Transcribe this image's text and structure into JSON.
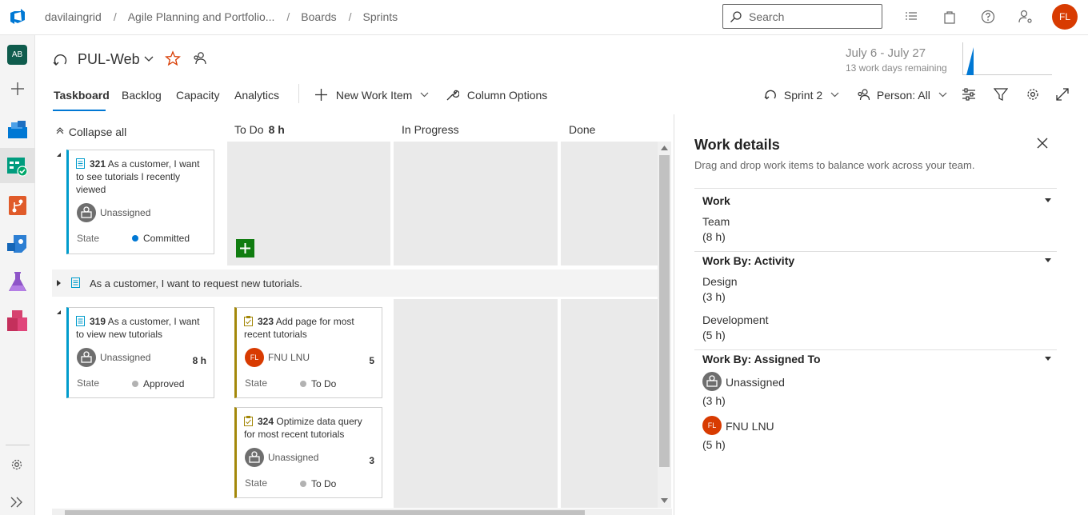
{
  "breadcrumb": [
    "davilaingrid",
    "Agile Planning and Portfolio...",
    "Boards",
    "Sprints"
  ],
  "search": {
    "placeholder": "Search"
  },
  "user": {
    "initials": "FL"
  },
  "project": {
    "badge": "AB"
  },
  "team": {
    "name": "PUL-Web"
  },
  "sprint": {
    "dates": "July 6 - July 27",
    "remaining": "13 work days remaining",
    "selector": "Sprint 2",
    "person_filter": "Person: All"
  },
  "tabs": [
    "Taskboard",
    "Backlog",
    "Capacity",
    "Analytics"
  ],
  "commands": {
    "new_work_item": "New Work Item",
    "column_options": "Column Options"
  },
  "board": {
    "collapse_all": "Collapse all",
    "columns": [
      {
        "name": "To Do",
        "hours": "8 h"
      },
      {
        "name": "In Progress"
      },
      {
        "name": "Done"
      }
    ],
    "collapsed_row": "As a customer, I want to request new tutorials.",
    "cards": {
      "c321": {
        "id": "321",
        "title": "As a customer, I want to see tutorials I recently viewed",
        "assignee": "Unassigned",
        "state_label": "State",
        "state": "Committed"
      },
      "c319": {
        "id": "319",
        "title": "As a customer, I want to view new tutorials",
        "assignee": "Unassigned",
        "remaining": "8 h",
        "state_label": "State",
        "state": "Approved"
      },
      "c323": {
        "id": "323",
        "title": "Add page for most recent tutorials",
        "assignee": "FNU LNU",
        "assignee_initials": "FL",
        "remaining": "5",
        "state_label": "State",
        "state": "To Do"
      },
      "c324": {
        "id": "324",
        "title": "Optimize data query for most recent tutorials",
        "assignee": "Unassigned",
        "remaining": "3",
        "state_label": "State",
        "state": "To Do"
      }
    }
  },
  "panel": {
    "title": "Work details",
    "subtitle": "Drag and drop work items to balance work across your team.",
    "work": {
      "header": "Work",
      "team_label": "Team",
      "team_hours": "(8 h)"
    },
    "activity": {
      "header": "Work By: Activity",
      "items": [
        {
          "name": "Design",
          "hours": "(3 h)"
        },
        {
          "name": "Development",
          "hours": "(5 h)"
        }
      ]
    },
    "assigned": {
      "header": "Work By: Assigned To",
      "items": [
        {
          "name": "Unassigned",
          "hours": "(3 h)"
        },
        {
          "name": "FNU LNU",
          "initials": "FL",
          "hours": "(5 h)"
        }
      ]
    }
  },
  "colors": {
    "accent": "#0078d4",
    "story": "#009ccc",
    "task": "#a4880a",
    "avatar": "#d83b01",
    "add": "#107c10",
    "committed": "#0078d4",
    "approved": "#b2b2b2",
    "todo": "#b2b2b2"
  }
}
